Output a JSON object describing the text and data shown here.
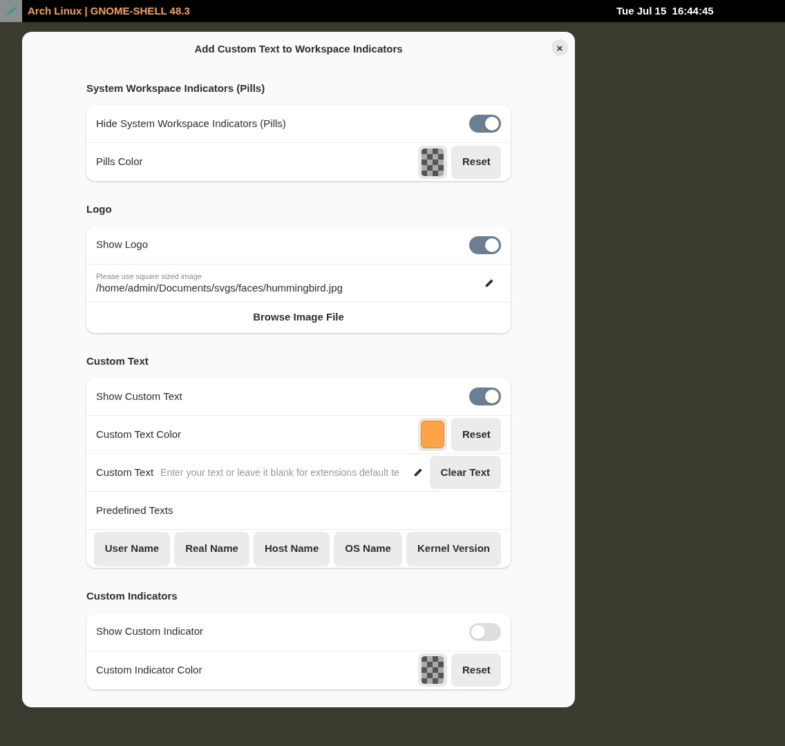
{
  "top_bar": {
    "title": "Arch Linux | GNOME-SHELL 48.3",
    "clock": "Tue Jul 15  16:44:45"
  },
  "dialog": {
    "title": "Add Custom Text to Workspace Indicators",
    "close": "×",
    "groups": [
      {
        "title": "System Workspace Indicators (Pills)",
        "rows": [
          {
            "kind": "switch",
            "label": "Hide System Workspace Indicators (Pills)",
            "on": true
          },
          {
            "kind": "color",
            "label": "Pills Color",
            "swatch": {
              "kind": "empty"
            },
            "button": "Reset"
          }
        ]
      },
      {
        "title": "Logo",
        "rows": [
          {
            "kind": "switch",
            "label": "Show Logo",
            "on": true
          },
          {
            "kind": "entry",
            "subtitle": "Please use square sized image",
            "value": "/home/admin/Documents/svgs/faces/hummingbird.jpg"
          },
          {
            "kind": "button",
            "label": "Browse Image File"
          }
        ]
      },
      {
        "title": "Custom Text",
        "rows": [
          {
            "kind": "switch",
            "label": "Show Custom Text",
            "on": true
          },
          {
            "kind": "color",
            "label": "Custom Text Color",
            "swatch": {
              "kind": "filled",
              "color": "#ffa348"
            },
            "button": "Reset"
          },
          {
            "kind": "text",
            "label": "Custom Text",
            "placeholder": "Enter your text or leave it blank for extensions default te",
            "button": "Clear Text"
          },
          {
            "kind": "label",
            "label": "Predefined Texts"
          },
          {
            "kind": "buttons",
            "buttons": [
              "User Name",
              "Real Name",
              "Host Name",
              "OS Name",
              "Kernel Version"
            ]
          }
        ]
      },
      {
        "title": "Custom Indicators",
        "rows": [
          {
            "kind": "switch",
            "label": "Show Custom Indicator",
            "on": false
          },
          {
            "kind": "color",
            "label": "Custom Indicator Color",
            "swatch": {
              "kind": "empty"
            },
            "button": "Reset"
          }
        ]
      }
    ]
  }
}
